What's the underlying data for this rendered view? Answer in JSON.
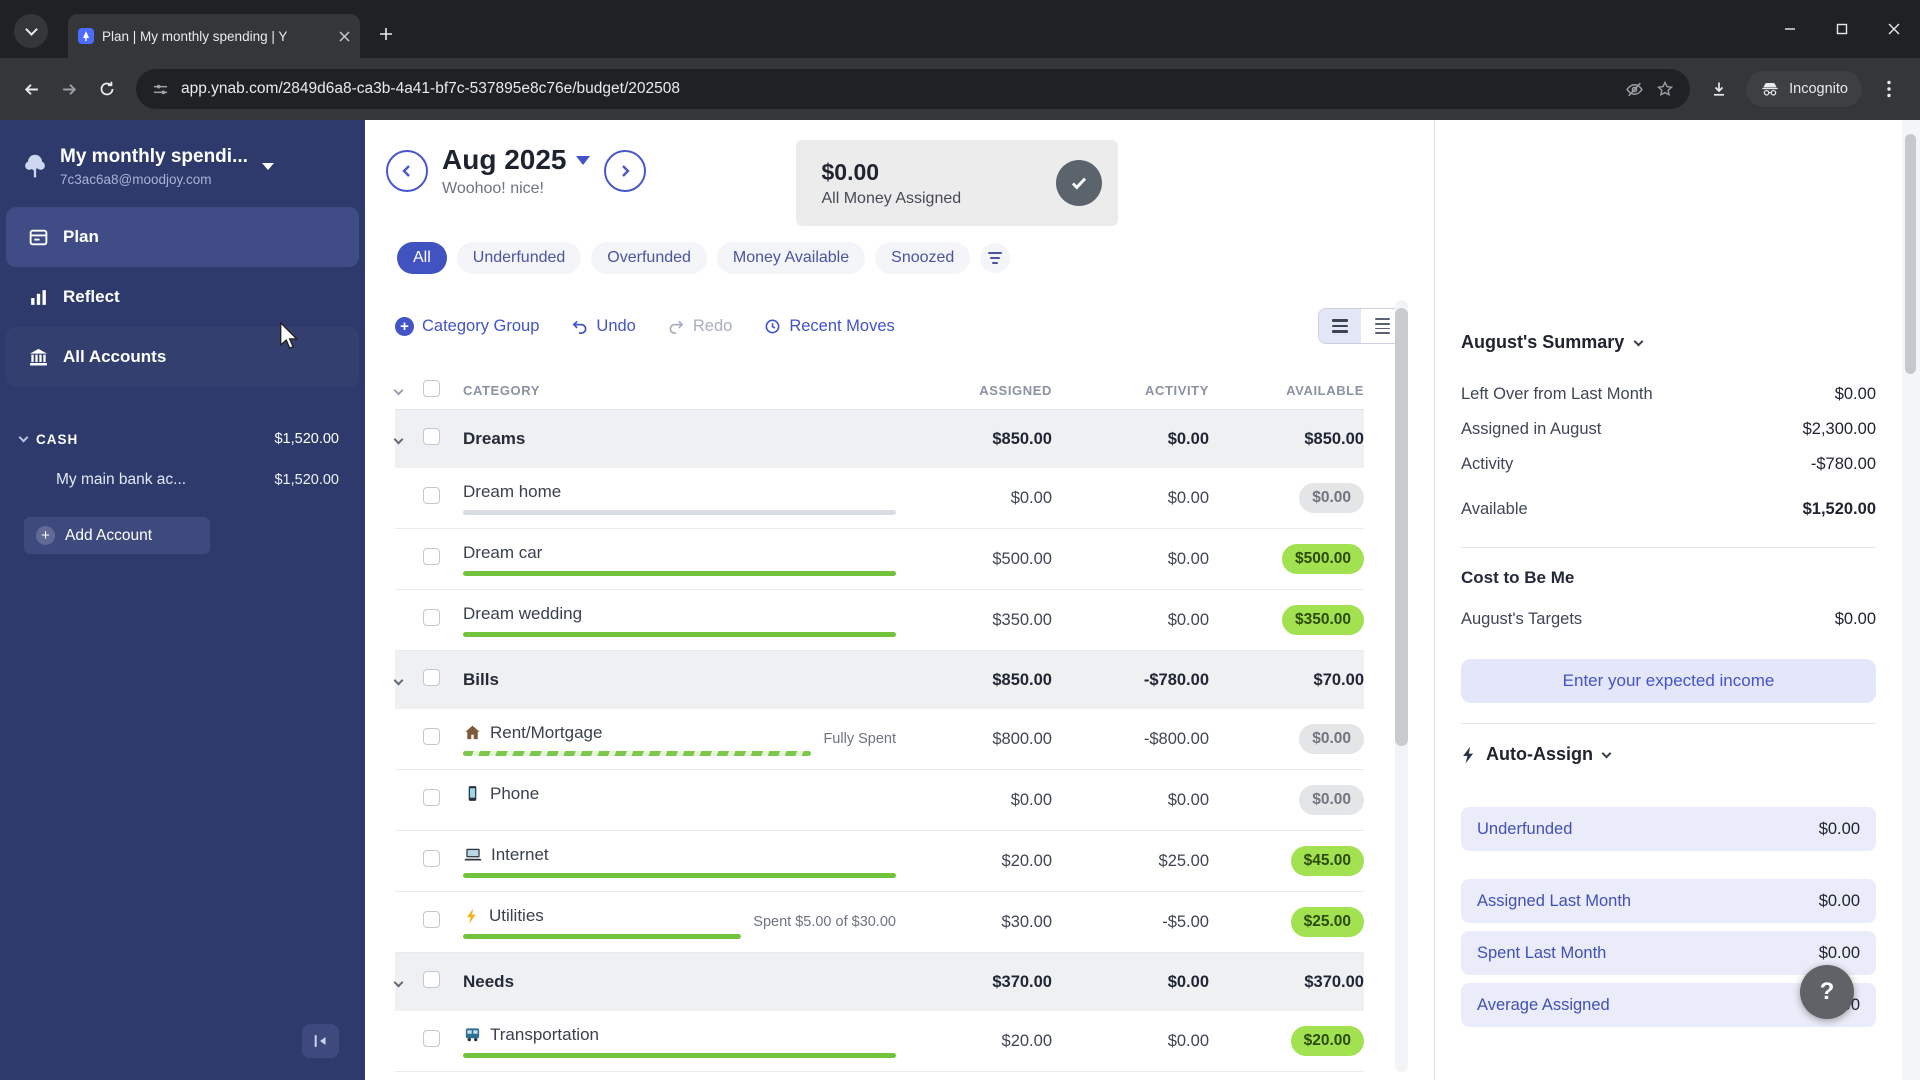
{
  "browser": {
    "tab_title": "Plan | My monthly spending | Y",
    "url": "app.ynab.com/2849d6a8-ca3b-4a41-bf7c-537895e8c76e/budget/202508",
    "incognito_label": "Incognito"
  },
  "icons": {
    "budget_logo": "tree",
    "nav_plan": "ledger",
    "nav_reflect": "bar-chart",
    "nav_all_accounts": "bank",
    "rent_mortgage": "house",
    "phone": "mobile-phone",
    "internet": "laptop",
    "utilities": "lightning-bolt",
    "transportation": "bus",
    "banner_check": "checkmark",
    "auto_assign": "lightning-bolt",
    "help": "question-mark"
  },
  "sidebar": {
    "budget_name": "My monthly spendi...",
    "email": "7c3ac6a8@moodjoy.com",
    "nav_plan": "Plan",
    "nav_reflect": "Reflect",
    "nav_accounts": "All Accounts",
    "cash_label": "CASH",
    "cash_total": "$1,520.00",
    "account_name": "My main bank ac...",
    "account_amount": "$1,520.00",
    "add_account": "Add Account"
  },
  "header": {
    "month": "Aug 2025",
    "subtitle": "Woohoo! nice!",
    "banner_amount": "$0.00",
    "banner_label": "All Money Assigned"
  },
  "filters": {
    "all": "All",
    "underfunded": "Underfunded",
    "overfunded": "Overfunded",
    "money_available": "Money Available",
    "snoozed": "Snoozed"
  },
  "toolbar": {
    "category_group": "Category Group",
    "undo": "Undo",
    "redo": "Redo",
    "recent_moves": "Recent Moves"
  },
  "table": {
    "col_category": "CATEGORY",
    "col_assigned": "ASSIGNED",
    "col_activity": "ACTIVITY",
    "col_available": "AVAILABLE",
    "groups": [
      {
        "name": "Dreams",
        "assigned": "$850.00",
        "activity": "$0.00",
        "available": "$850.00",
        "rows": [
          {
            "name": "Dream home",
            "assigned": "$0.00",
            "activity": "$0.00",
            "available": "$0.00"
          },
          {
            "name": "Dream car",
            "assigned": "$500.00",
            "activity": "$0.00",
            "available": "$500.00"
          },
          {
            "name": "Dream wedding",
            "assigned": "$350.00",
            "activity": "$0.00",
            "available": "$350.00"
          }
        ]
      },
      {
        "name": "Bills",
        "assigned": "$850.00",
        "activity": "-$780.00",
        "available": "$70.00",
        "rows": [
          {
            "name": "Rent/Mortgage",
            "note": "Fully Spent",
            "assigned": "$800.00",
            "activity": "-$800.00",
            "available": "$0.00"
          },
          {
            "name": "Phone",
            "assigned": "$0.00",
            "activity": "$0.00",
            "available": "$0.00"
          },
          {
            "name": "Internet",
            "assigned": "$20.00",
            "activity": "$25.00",
            "available": "$45.00"
          },
          {
            "name": "Utilities",
            "note": "Spent $5.00 of $30.00",
            "assigned": "$30.00",
            "activity": "-$5.00",
            "available": "$25.00"
          }
        ]
      },
      {
        "name": "Needs",
        "assigned": "$370.00",
        "activity": "$0.00",
        "available": "$370.00",
        "rows": [
          {
            "name": "Transportation",
            "assigned": "$20.00",
            "activity": "$0.00",
            "available": "$20.00"
          }
        ]
      }
    ]
  },
  "inspector": {
    "summary_title": "August's Summary",
    "left_over_label": "Left Over from Last Month",
    "left_over_value": "$0.00",
    "assigned_label": "Assigned in August",
    "assigned_value": "$2,300.00",
    "activity_label": "Activity",
    "activity_value": "-$780.00",
    "available_label": "Available",
    "available_value": "$1,520.00",
    "cost_to_be_me": "Cost to Be Me",
    "targets_label": "August's Targets",
    "targets_value": "$0.00",
    "income_button": "Enter your expected income",
    "auto_assign_title": "Auto-Assign",
    "underfunded_label": "Underfunded",
    "underfunded_value": "$0.00",
    "assigned_last_label": "Assigned Last Month",
    "assigned_last_value": "$0.00",
    "spent_last_label": "Spent Last Month",
    "spent_last_value": "$0.00",
    "average_assigned_label": "Average Assigned",
    "average_assigned_value": "$0.00",
    "help_label": "?"
  }
}
